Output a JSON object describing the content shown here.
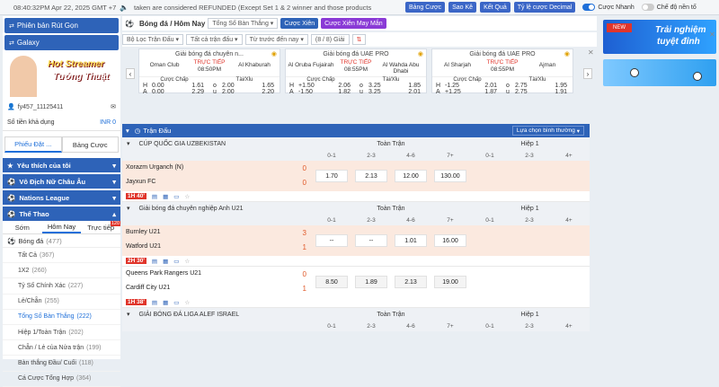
{
  "topbar": {
    "time": "08:40:32PM Apr 22, 2025 GMT +7",
    "marquee": "taken are considered REFUNDED (Except Set 1 & 2 winner and those products",
    "buttons": [
      "Bảng Cược",
      "Sao Kê",
      "Kết Quả",
      "Tỷ lệ cược Decimal"
    ],
    "toggle1": "Cược Nhanh",
    "toggle2": "Chế độ nền tố"
  },
  "left": {
    "version_btn": "Phiên bản Rút Gọn",
    "galaxy_btn": "Galaxy",
    "banner_line1": "Hot Streamer",
    "banner_line2": "Tướng Thuật",
    "account": "fy457_11125411",
    "balance_label": "Số tiền khả dụng",
    "balance_value": "INR 0",
    "slip_tabs": [
      "Phiếu Đặt ...",
      "Bảng Cược"
    ],
    "fav": "Yêu thích của tôi",
    "euro": "Vô Địch Nữ Châu Âu",
    "nations": "Nations League",
    "sports": "Thể Thao",
    "time_tabs": [
      "Sớm",
      "Hôm Nay",
      "Trực tiếp"
    ],
    "live_count": "120",
    "sport_name": "Bóng đá",
    "sport_count": "(477)",
    "items": [
      {
        "label": "Tất Cả",
        "count": "(367)"
      },
      {
        "label": "1X2",
        "count": "(260)"
      },
      {
        "label": "Tỷ Số Chính Xác",
        "count": "(227)"
      },
      {
        "label": "Lẻ/Chẵn",
        "count": "(255)"
      },
      {
        "label": "Tổng Số Bàn Thắng",
        "count": "(222)"
      },
      {
        "label": "Hiệp 1/Toàn Trận",
        "count": "(202)"
      },
      {
        "label": "Chẵn / Lẻ của Nửa trận",
        "count": "(199)"
      },
      {
        "label": "Bàn thắng Đầu/ Cuối",
        "count": "(118)"
      },
      {
        "label": "Cá Cược Tổng Hợp",
        "count": "(364)"
      }
    ]
  },
  "main": {
    "crumb": "Bóng đá / Hôm Nay",
    "market_select": "Tổng Số Bàn Thắng",
    "combo_btn": "Cược Xiên",
    "combo_luck_btn": "Cược Xiên May Mắn",
    "filter1": "Bộ Lọc Trận Đấu",
    "filter2": "Tất cả trận đấu",
    "filter3": "Từ trước đến nay",
    "count": "(8 / 8) Giải",
    "cards": [
      {
        "league": "Giải bóng đá chuyên n...",
        "home": "Oman Club",
        "away": "Al Khaburah",
        "live": "TRỰC TIẾP",
        "time": "08:50PM",
        "hdr1": "Cược Chấp",
        "hdr2": "Tài/Xỉu",
        "r1": [
          "H",
          "0.00",
          "1.61",
          "o",
          "2.00",
          "1.65"
        ],
        "r2": [
          "A",
          "0.00",
          "2.29",
          "u",
          "2.00",
          "2.20"
        ]
      },
      {
        "league": "Giải bóng đá UAE PRO",
        "home": "Al Oruba Fujairah",
        "away": "Al Wahda Abu Dhabi",
        "live": "TRỰC TIẾP",
        "time": "08:55PM",
        "hdr1": "Cược Chấp",
        "hdr2": "Tài/Xỉu",
        "r1": [
          "H",
          "+1.50",
          "2.06",
          "o",
          "3.25",
          "1.85"
        ],
        "r2": [
          "A",
          "-1.50",
          "1.82",
          "u",
          "3.25",
          "2.01"
        ]
      },
      {
        "league": "Giải bóng đá UAE PRO",
        "home": "Al Sharjah",
        "away": "Ajman",
        "live": "TRỰC TIẾP",
        "time": "08:55PM",
        "hdr1": "Cược Chấp",
        "hdr2": "Tài/Xỉu",
        "r1": [
          "H",
          "-1.25",
          "2.01",
          "o",
          "2.75",
          "1.95"
        ],
        "r2": [
          "A",
          "+1.25",
          "1.87",
          "u",
          "2.75",
          "1.91"
        ]
      }
    ],
    "table_title": "Trận Đấu",
    "sort_btn": "Lựa chọn bình thường",
    "ft_label": "Toàn Trận",
    "ht_label": "Hiệp 1",
    "cols_ft": [
      "0-1",
      "2-3",
      "4-6",
      "7+"
    ],
    "cols_ht": [
      "0-1",
      "2-3",
      "4+"
    ],
    "leagues": [
      {
        "name": "CÚP QUỐC GIA UZBEKISTAN",
        "matches": [
          {
            "home": "Xorazm Urganch (N)",
            "away": "Jayxun FC",
            "hs": "0",
            "as": "0",
            "odds": [
              "1.70",
              "2.13",
              "12.00",
              "130.00"
            ],
            "live": "1H",
            "min": "40'"
          }
        ]
      },
      {
        "name": "Giải bóng đá chuyên nghiệp Anh U21",
        "matches": [
          {
            "home": "Burnley U21",
            "away": "Watford U21",
            "hs": "3",
            "as": "1",
            "odds": [
              "--",
              "--",
              "1.01",
              "16.00"
            ],
            "live": "2H",
            "min": "30'"
          },
          {
            "home": "Queens Park Rangers U21",
            "away": "Cardiff City U21",
            "hs": "0",
            "as": "1",
            "odds": [
              "8.50",
              "1.89",
              "2.13",
              "19.00"
            ],
            "live": "1H",
            "min": "38'"
          }
        ]
      },
      {
        "name": "GIẢI BÓNG ĐÁ LIGA ALEF ISRAEL",
        "matches": []
      }
    ]
  },
  "right": {
    "promo_badge": "NEW",
    "promo_line1": "Trải nghiệm",
    "promo_line2": "tuyệt đỉnh"
  }
}
